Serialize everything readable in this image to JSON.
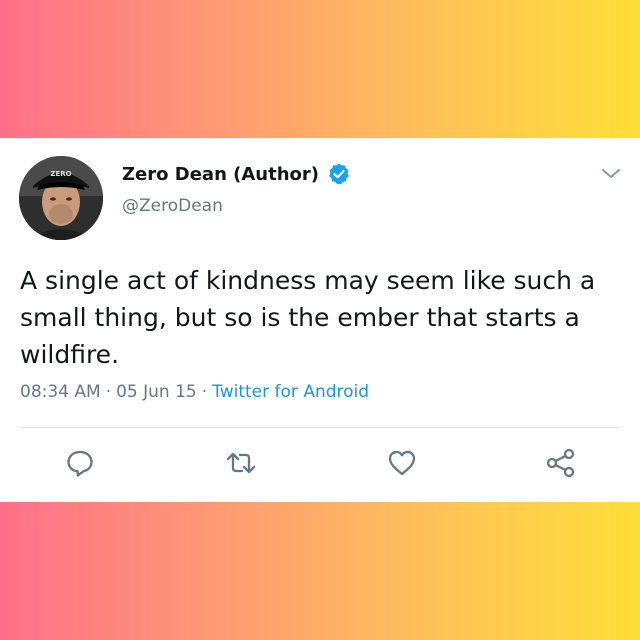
{
  "tweet": {
    "author_name": "Zero Dean (Author)",
    "handle": "@ZeroDean",
    "avatar_cap_text": "ZERO",
    "text": "A single act of kindness may seem like such a small thing, but so is the ember that starts a wildfire.",
    "time": "08:34 AM",
    "date": "05 Jun 15",
    "separator": "·",
    "client": "Twitter for Android"
  },
  "icons": {
    "verified": "verified-badge-icon",
    "menu": "chevron-down-icon",
    "reply": "reply-icon",
    "retweet": "retweet-icon",
    "like": "heart-icon",
    "share": "share-icon"
  },
  "colors": {
    "gradient_left": "#fe6f8a",
    "gradient_right": "#fdde38",
    "verified_blue": "#1da1f2",
    "link_blue": "#1b95e0",
    "secondary_text": "#657786",
    "icon_gray": "#657786",
    "text": "#14171a"
  }
}
